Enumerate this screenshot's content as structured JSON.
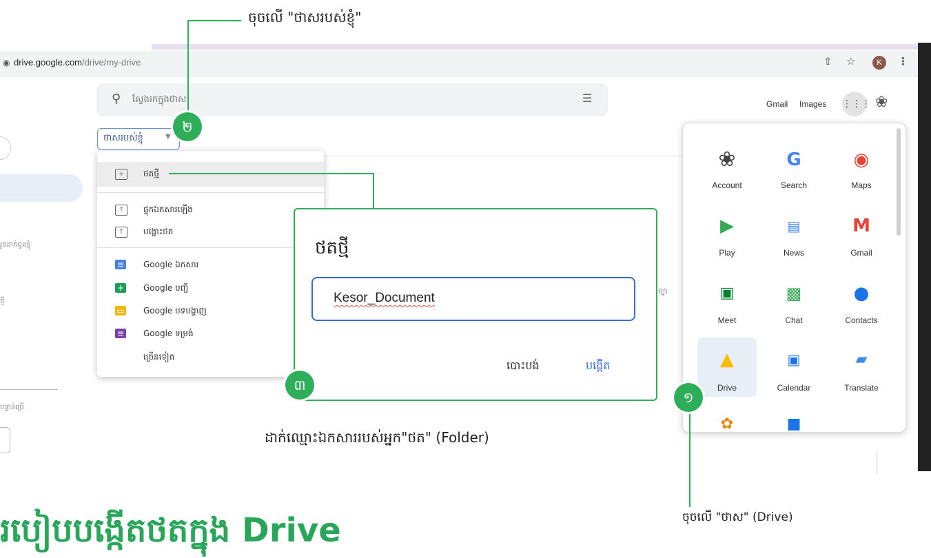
{
  "browser": {
    "url_host": "drive.google.com",
    "url_path": "/drive/my-drive",
    "avatar_letter": "K",
    "share_icon": "share-icon",
    "star_icon": "star-icon",
    "menu_icon": "kebab-menu-icon"
  },
  "search": {
    "placeholder": "ស្វែងរកក្នុងថាស"
  },
  "header": {
    "gmail": "Gmail",
    "images": "Images"
  },
  "sidebar_ghost": {
    "item1": "រួចដាក់ជូនខ្ញុំ",
    "item2": "ថ្មី",
    "item3": "បន្ទាន់ប្រើ"
  },
  "mydrive": {
    "label": "ថាសរបស់ខ្ញុំ"
  },
  "menu": {
    "items": [
      {
        "label": "ថតថ្មី",
        "icon": "new-folder-icon"
      },
      {
        "label": "ផ្ទុកឯកសារឡើង",
        "icon": "file-upload-icon"
      },
      {
        "label": "បង្ហោះថត",
        "icon": "folder-upload-icon"
      },
      {
        "label": "Google ឯកសារ",
        "icon": "google-docs-icon"
      },
      {
        "label": "Google បញ្ជី",
        "icon": "google-sheets-icon"
      },
      {
        "label": "Google បទបង្ហាញ",
        "icon": "google-slides-icon"
      },
      {
        "label": "Google ទម្រង់",
        "icon": "google-forms-icon"
      },
      {
        "label": "ច្រើនទៀត",
        "icon": ""
      }
    ]
  },
  "dialog": {
    "title": "ថតថ្មី",
    "input_value": "Kesor_Document",
    "cancel": "បោះបង់",
    "create": "បង្កើត"
  },
  "ghost_right": "តិច្បា",
  "apps": [
    {
      "label": "Account",
      "icon": "account-icon"
    },
    {
      "label": "Search",
      "icon": "google-search-icon"
    },
    {
      "label": "Maps",
      "icon": "maps-icon"
    },
    {
      "label": "Play",
      "icon": "play-icon"
    },
    {
      "label": "News",
      "icon": "news-icon"
    },
    {
      "label": "Gmail",
      "icon": "gmail-icon"
    },
    {
      "label": "Meet",
      "icon": "meet-icon"
    },
    {
      "label": "Chat",
      "icon": "chat-icon"
    },
    {
      "label": "Contacts",
      "icon": "contacts-icon"
    },
    {
      "label": "Drive",
      "icon": "drive-icon"
    },
    {
      "label": "Calendar",
      "icon": "calendar-icon"
    },
    {
      "label": "Translate",
      "icon": "translate-icon"
    }
  ],
  "annotations": {
    "top_note": "ចុចលើ \"ថាសរបស់ខ្ញុំ\"",
    "middle_note": "ដាក់ឈ្មោះឯកសាររបស់អ្នក\"ថត\" (Folder)",
    "bottom_note": "ចុចលើ \"ថាស\" (Drive)",
    "step1": "១",
    "step2": "២",
    "step3": "៣",
    "heading": "របៀបបង្កើតថតក្នុង Drive"
  },
  "colors": {
    "annotation_green": "#2fae5a",
    "dialog_blue": "#3b6ad4"
  }
}
